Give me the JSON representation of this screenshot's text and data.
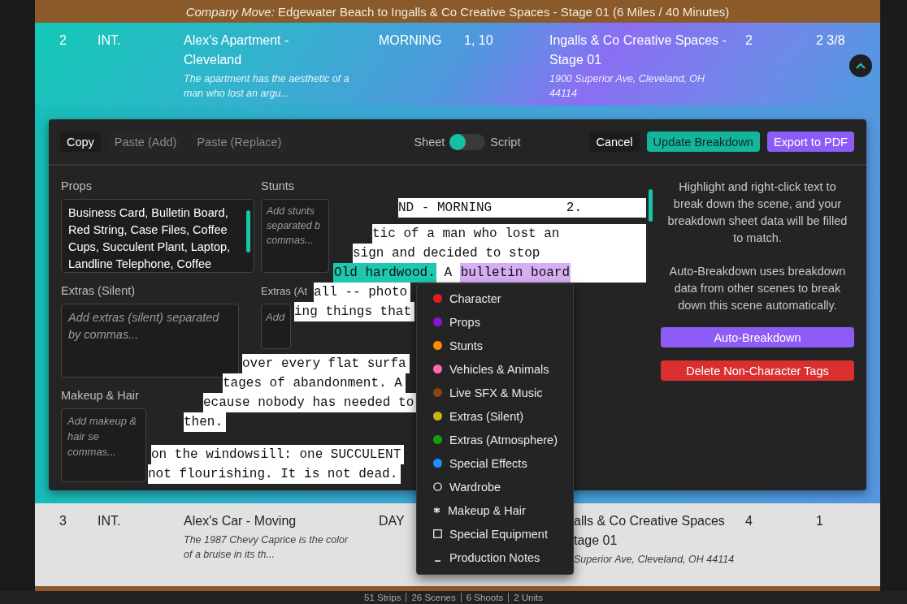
{
  "company_move": "*Company Move:* Edgewater Beach to Ingalls & Co Creative Spaces - Stage 01 (6 Miles / 40 Minutes)",
  "rows": [
    {
      "scene": "2",
      "int_ext": "INT.",
      "set": "Alex's Apartment - Cleveland",
      "description": "The apartment has the aesthetic of a man who lost an argu...",
      "time": "MORNING",
      "cast": "1, 10",
      "location": "Ingalls & Co Creative Spaces - Stage 01",
      "address": "1900 Superior Ave, Cleveland, OH 44114",
      "column_7": "2",
      "column_8": "2 3/8",
      "expanded": true
    },
    {
      "scene": "3",
      "int_ext": "INT.",
      "set": "Alex's Car - Moving",
      "description": "The 1987 Chevy Caprice is the color of a bruise in its th...",
      "time": "DAY",
      "location": "alls & Co Creative Spaces tage 01",
      "address": "Superior Ave, Cleveland, OH 44114",
      "column_7": "4",
      "column_8": "1",
      "expanded": false
    }
  ],
  "toolbar": {
    "left_buttons": [
      {
        "label": "Copy",
        "disabled": false
      },
      {
        "label": "Paste (Add)",
        "disabled": true
      },
      {
        "label": "Paste (Replace)",
        "disabled": true
      }
    ],
    "mode_toggle": {
      "left_label": "Sheet",
      "right_label": "Script",
      "on": false
    },
    "right_buttons": [
      {
        "label": "Cancel",
        "kind": "plain"
      },
      {
        "label": "Update Breakdown",
        "kind": "primary"
      },
      {
        "label": "Export to PDF",
        "kind": "accent"
      }
    ]
  },
  "fields": [
    {
      "label": "Props",
      "value": "Business Card, Bulletin Board, Red String, Case Files, Coffee Cups, Succulent Plant, Laptop, Landline Telephone, Coffee"
    },
    {
      "label": "Stunts",
      "placeholder": "Add stunts separated b\ncommas..."
    },
    {
      "label": "Extras (Silent)",
      "placeholder": "Add extras (silent) separated by commas..."
    },
    {
      "label": "Extras (At",
      "placeholder": "Add"
    },
    {
      "label": "Makeup & Hair",
      "placeholder": "Add makeup & hair se\ncommas..."
    }
  ],
  "script": {
    "header": {
      "text": "ND - MORNING",
      "page": "2."
    },
    "paragraphs": [
      [
        [
          {
            "text": "tic of a man who lost an"
          }
        ],
        [
          {
            "text": "sign and decided to stop"
          }
        ],
        [
          {
            "text": "Old hardwood.",
            "color": "#1ec8b0"
          },
          {
            "text": " A "
          },
          {
            "text": "bulletin board",
            "color": "#d6aef2"
          }
        ],
        [
          {
            "text": "all -- photo"
          }
        ],
        [
          {
            "text": "ing things that"
          }
        ]
      ],
      [
        [
          {
            "text": "over every flat surfa"
          }
        ],
        [
          {
            "text": "tages of abandonment. A"
          }
        ],
        [
          {
            "text": "ecause nobody has needed to"
          }
        ],
        [
          {
            "text": "then."
          }
        ]
      ],
      [
        [
          {
            "text": "on the windowsill: one SUCCULENT"
          }
        ],
        [
          {
            "text": "not flourishing. It is not dead."
          }
        ]
      ]
    ]
  },
  "help": [
    "Highlight and right-click text to break down the scene, and your breakdown sheet data will be filled to match.",
    "Auto-Breakdown uses breakdown data from other scenes to break down this scene automatically."
  ],
  "side_buttons": [
    {
      "label": "Auto-Breakdown",
      "kind": "accent"
    },
    {
      "label": "Delete Non-Character Tags",
      "kind": "danger"
    }
  ],
  "context_menu": [
    {
      "label": "Character",
      "kind": "dot",
      "color": "#e01e1e"
    },
    {
      "label": "Props",
      "kind": "dot",
      "color": "#8a12d6"
    },
    {
      "label": "Stunts",
      "kind": "dot",
      "color": "#ff8c00"
    },
    {
      "label": "Vehicles & Animals",
      "kind": "dot",
      "color": "#ff69b4"
    },
    {
      "label": "Live SFX & Music",
      "kind": "dot",
      "color": "#8b4513"
    },
    {
      "label": "Extras (Silent)",
      "kind": "dot",
      "color": "#c8b414"
    },
    {
      "label": "Extras (Atmosphere)",
      "kind": "dot",
      "color": "#12a012"
    },
    {
      "label": "Special Effects",
      "kind": "dot",
      "color": "#1e8fff"
    },
    {
      "label": "Wardrobe",
      "kind": "circle"
    },
    {
      "label": "Makeup & Hair",
      "kind": "asterisk"
    },
    {
      "label": "Special Equipment",
      "kind": "square"
    },
    {
      "label": "Production Notes",
      "kind": "underscore"
    }
  ],
  "status_bar": [
    "51 Strips",
    "26 Scenes",
    "6 Shoots",
    "2 Units"
  ]
}
